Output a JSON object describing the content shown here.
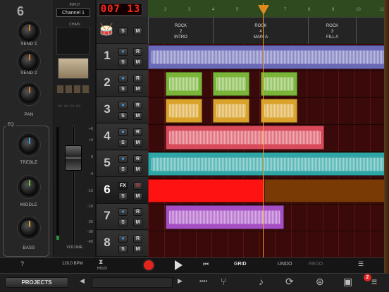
{
  "channel_strip": {
    "track_number": "6",
    "send1_label": "SEND 1",
    "send2_label": "SEND 2",
    "pan_label": "PAN",
    "eq_label": "EQ",
    "treble_label": "TREBLE",
    "middle_label": "MIDDLE",
    "bass_label": "BASS",
    "input_label": "INPUT",
    "input_value": "Channel 1",
    "chain_label": "CHAIN",
    "volume_label": "VOLUME",
    "db_scale": [
      "+6",
      "+4",
      "0",
      "-4",
      "-10",
      "-18",
      "-26",
      "-36",
      "-60"
    ]
  },
  "transport": {
    "counter": "007 13"
  },
  "ruler": {
    "bars": [
      "2",
      "3",
      "4",
      "5",
      "6",
      "7",
      "8",
      "9",
      "10",
      "11"
    ]
  },
  "sections": [
    {
      "name": "ROCK",
      "num": "2",
      "label": "INTRO"
    },
    {
      "name": "ROCK",
      "num": "4",
      "label": "MAIN A"
    },
    {
      "name": "ROCK",
      "num": "3",
      "label": "FILL A"
    }
  ],
  "tracks": [
    {
      "number": "1",
      "color": "#6a6ab8"
    },
    {
      "number": "2",
      "color": "#7ab53a"
    },
    {
      "number": "3",
      "color": "#d9a22a"
    },
    {
      "number": "4",
      "color": "#d94a5a"
    },
    {
      "number": "5",
      "color": "#2fa5a5"
    },
    {
      "number": "6",
      "color": "#ff1212"
    },
    {
      "number": "7",
      "color": "#a64fc4"
    },
    {
      "number": "8",
      "color": "#3a0a0a"
    }
  ],
  "buttons": {
    "solo": "S",
    "mute": "M",
    "record": "R",
    "fx": "FX"
  },
  "control_bar": {
    "help": "?",
    "tempo": "120.0 BPM",
    "hold": "HOLD",
    "grid": "GRID",
    "undo": "UNDO",
    "redo": "REDO"
  },
  "bottom_bar": {
    "projects_label": "PROJECTS",
    "notification_count": "2"
  },
  "colors": {
    "accent": "#ff9a1f",
    "record": "#e3241c",
    "monitor": "#39a7ff"
  }
}
